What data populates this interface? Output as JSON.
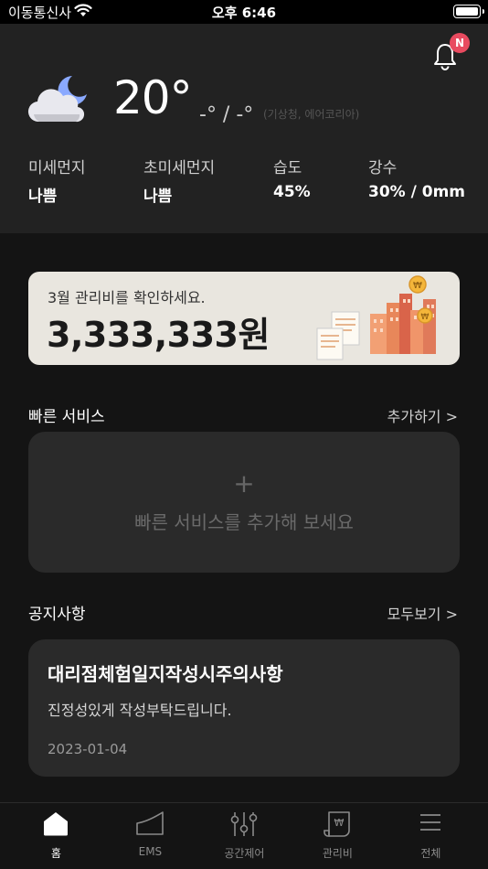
{
  "status_bar": {
    "carrier": "이동통신사",
    "time": "오후 6:46"
  },
  "notification": {
    "badge": "N"
  },
  "weather": {
    "temperature": "20°",
    "min_max": "-° / -°",
    "source": "(기상청, 에어코리아)",
    "metrics": [
      {
        "label": "미세먼지",
        "value": "나쁨"
      },
      {
        "label": "초미세먼지",
        "value": "나쁨"
      },
      {
        "label": "습도",
        "value": "45%"
      },
      {
        "label": "강수",
        "value": "30% / 0mm"
      }
    ]
  },
  "bill": {
    "subtitle": "3월 관리비를 확인하세요.",
    "amount": "3,333,333원"
  },
  "quick_service": {
    "title": "빠른 서비스",
    "link": "추가하기 >",
    "plus": "+",
    "empty_text": "빠른 서비스를 추가해 보세요"
  },
  "notice": {
    "title": "공지사항",
    "link": "모두보기 >",
    "item": {
      "title": "대리점체험일지작성시주의사항",
      "body": "진정성있게 작성부탁드립니다.",
      "date": "2023-01-04"
    }
  },
  "tabs": [
    {
      "label": "홈",
      "icon": "home-icon",
      "active": true
    },
    {
      "label": "EMS",
      "icon": "ems-icon",
      "active": false
    },
    {
      "label": "공간제어",
      "icon": "sliders-icon",
      "active": false
    },
    {
      "label": "관리비",
      "icon": "bill-icon",
      "active": false
    },
    {
      "label": "전체",
      "icon": "menu-icon",
      "active": false
    }
  ],
  "colors": {
    "background": "#141414",
    "header": "#222222",
    "card": "#2a2a2a",
    "bill_card": "#e9e6df",
    "badge": "#e84a5f"
  }
}
